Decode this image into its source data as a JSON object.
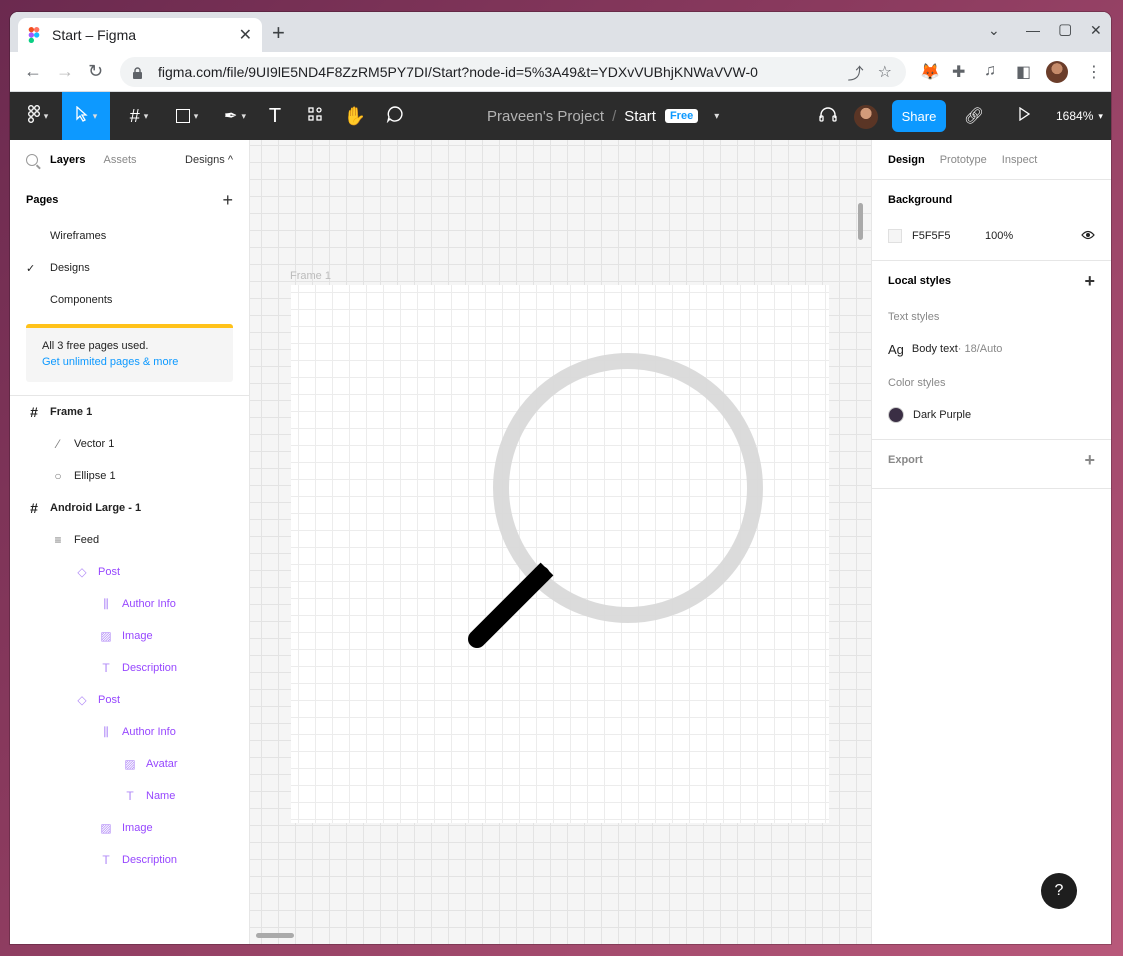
{
  "browser": {
    "tab_title": "Start – Figma",
    "tab_close": "✕",
    "new_tab": "+",
    "url": "figma.com/file/9UI9lE5ND4F8ZzRM5PY7DI/Start?node-id=5%3A49&t=YDXvVUBhjKNWaVVW-0"
  },
  "figma_bar": {
    "project_name": "Praveen's Project",
    "separator": "/",
    "file_name": "Start",
    "plan_badge": "Free",
    "share_label": "Share",
    "zoom_level": "1684%"
  },
  "left_panel": {
    "tabs": {
      "layers": "Layers",
      "assets": "Assets",
      "page_switch": "Designs ^"
    },
    "pages_title": "Pages",
    "pages": [
      {
        "name": "Wireframes",
        "selected": false
      },
      {
        "name": "Designs",
        "selected": true
      },
      {
        "name": "Components",
        "selected": false
      }
    ],
    "notice_text": "All 3 free pages used.",
    "notice_link": "Get unlimited pages & more",
    "layers": [
      {
        "name": "Frame 1",
        "icon": "frame-icon",
        "indent": 0,
        "bold": true,
        "component": false
      },
      {
        "name": "Vector 1",
        "icon": "vector-icon",
        "indent": 1,
        "bold": false,
        "component": false
      },
      {
        "name": "Ellipse 1",
        "icon": "ellipse-icon",
        "indent": 1,
        "bold": false,
        "component": false
      },
      {
        "name": "Android Large - 1",
        "icon": "frame-icon",
        "indent": 0,
        "bold": true,
        "component": false
      },
      {
        "name": "Feed",
        "icon": "text-layout-icon",
        "indent": 1,
        "bold": false,
        "component": false
      },
      {
        "name": "Post",
        "icon": "instance-icon",
        "indent": 2,
        "bold": false,
        "component": true
      },
      {
        "name": "Author Info",
        "icon": "autolayout-icon",
        "indent": 3,
        "bold": false,
        "component": true
      },
      {
        "name": "Image",
        "icon": "image-icon",
        "indent": 3,
        "bold": false,
        "component": true
      },
      {
        "name": "Description",
        "icon": "text-icon",
        "indent": 3,
        "bold": false,
        "component": true
      },
      {
        "name": "Post",
        "icon": "instance-icon",
        "indent": 2,
        "bold": false,
        "component": true
      },
      {
        "name": "Author Info",
        "icon": "autolayout-icon",
        "indent": 3,
        "bold": false,
        "component": true
      },
      {
        "name": "Avatar",
        "icon": "image-icon",
        "indent": 4,
        "bold": false,
        "component": true
      },
      {
        "name": "Name",
        "icon": "text-icon",
        "indent": 4,
        "bold": false,
        "component": true
      },
      {
        "name": "Image",
        "icon": "image-icon",
        "indent": 3,
        "bold": false,
        "component": true
      },
      {
        "name": "Description",
        "icon": "text-icon",
        "indent": 3,
        "bold": false,
        "component": true
      }
    ]
  },
  "canvas": {
    "frame_label": "Frame 1"
  },
  "right_panel": {
    "tabs": {
      "design": "Design",
      "prototype": "Prototype",
      "inspect": "Inspect"
    },
    "background_title": "Background",
    "background_hex": "F5F5F5",
    "background_opacity": "100%",
    "local_styles_title": "Local styles",
    "text_styles_title": "Text styles",
    "text_style_sample": "Ag",
    "text_style_name": "Body text",
    "text_style_meta": " · 18/Auto",
    "color_styles_title": "Color styles",
    "color_style_name": "Dark Purple",
    "export_title": "Export"
  },
  "help_label": "?",
  "colors": {
    "accent": "#0d99ff",
    "toolbar_bg": "#2c2c2c",
    "component_purple": "#9747ff",
    "dark_purple_swatch": "#3a2e44",
    "notice_bar": "#ffc21a"
  }
}
